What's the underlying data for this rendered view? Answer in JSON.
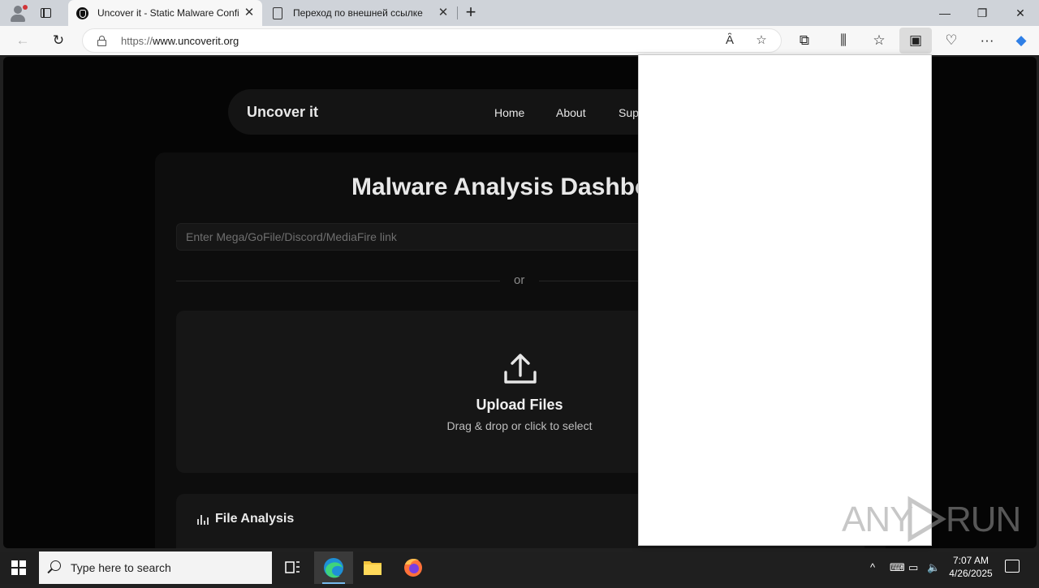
{
  "browser": {
    "tabs": [
      {
        "title": "Uncover it - Static Malware Confi",
        "active": true,
        "icon": "shield-icon"
      },
      {
        "title": "Переход по внешней ссылке",
        "active": false,
        "icon": "page-icon"
      }
    ],
    "address": {
      "scheme": "https://",
      "host": "www.uncoverit.org"
    },
    "icons": {
      "back": "←",
      "refresh": "↻",
      "read_aloud": "Ȃ",
      "favorite": "☆",
      "extensions": "⧉",
      "split": "⫼",
      "favorites": "☆",
      "collections": "▣",
      "performance": "♡",
      "menu": "···",
      "copilot": "◆",
      "close_tab": "✕",
      "new_tab": "+",
      "minimize": "—",
      "maximize": "❐",
      "close": "✕"
    }
  },
  "site": {
    "brand": "Uncover it",
    "nav": [
      "Home",
      "About",
      "Sup"
    ],
    "title": "Malware Analysis Dashbo",
    "link_placeholder": "Enter Mega/GoFile/Discord/MediaFire link",
    "divider": "or",
    "upload": {
      "title": "Upload Files",
      "subtitle": "Drag & drop or click to select"
    },
    "analysis": {
      "title": "File Analysis"
    }
  },
  "watermark": {
    "left": "ANY",
    "right": "RUN"
  },
  "taskbar": {
    "search_placeholder": "Type here to search",
    "time": "7:07 AM",
    "date": "4/26/2025",
    "tray_icons": {
      "chevron": "^",
      "meet": "⌨",
      "network": "▭",
      "volume": "🔈"
    }
  },
  "colors": {
    "accent": "#76b9ed",
    "page_bg": "#050505",
    "card_bg": "#161616"
  }
}
